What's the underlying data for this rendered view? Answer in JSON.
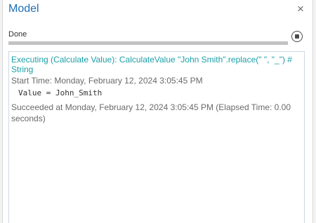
{
  "window": {
    "title": "Model",
    "close_label": "×"
  },
  "progress": {
    "status": "Done",
    "fill": 1.0
  },
  "log": {
    "executing": "Executing (Calculate Value): CalculateValue \"John Smith\".replace(\" \", \"_\") # String",
    "start_time": "Start Time: Monday, February 12, 2024 3:05:45 PM",
    "value": "Value = John_Smith",
    "succeeded": "Succeeded at Monday, February 12, 2024 3:05:45 PM (Elapsed Time: 0.00 seconds)"
  },
  "colors": {
    "title": "#1e6fb8",
    "executing_text": "#1a9fa8",
    "muted_text": "#6a6a6a"
  },
  "icons": {
    "close": "close-icon",
    "stop": "stop-icon"
  }
}
